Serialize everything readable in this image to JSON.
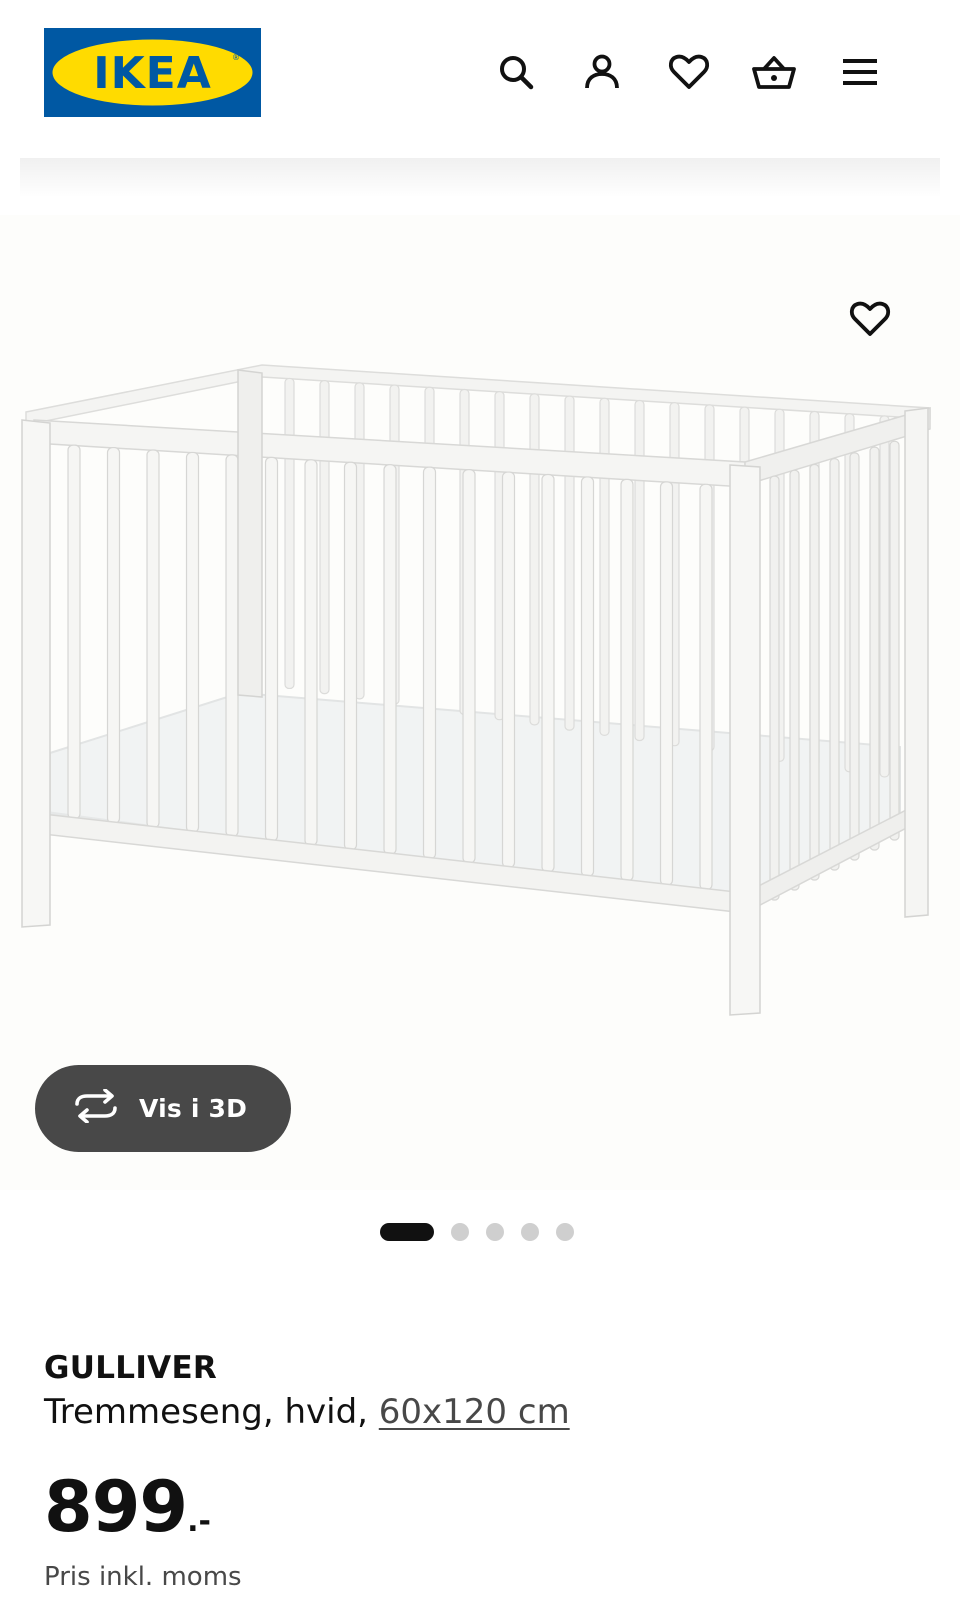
{
  "header": {
    "logo_text": "IKEA",
    "icons": [
      "search-icon",
      "user-icon",
      "heart-icon",
      "basket-icon",
      "menu-icon"
    ]
  },
  "product": {
    "image_description_icon": "crib-image",
    "view_3d_label": "Vis i 3D",
    "carousel": {
      "count": 5,
      "active": 1
    },
    "name": "GULLIVER",
    "description": "Tremmeseng, hvid, ",
    "size_link": "60x120 cm",
    "price_integer": "899",
    "price_suffix": ".-",
    "price_note": "Pris inkl. moms"
  },
  "colors": {
    "ikea_blue": "#0058A3",
    "ikea_yellow": "#FFDB00",
    "button_dark": "#484848",
    "text": "#111111"
  }
}
